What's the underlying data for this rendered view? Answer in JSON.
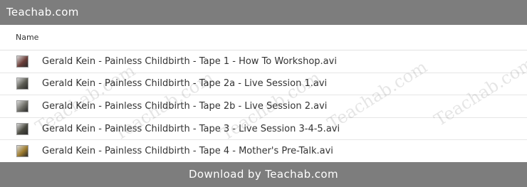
{
  "window": {
    "title": "Teachab.com"
  },
  "list": {
    "column_name": "Name",
    "files": [
      {
        "name": "Gerald Kein - Painless Childbirth - Tape 1 - How To Workshop.avi",
        "thumb_color": "#6b3d38"
      },
      {
        "name": "Gerald Kein - Painless Childbirth - Tape 2a - Live Session 1.avi",
        "thumb_color": "#5a5a52"
      },
      {
        "name": "Gerald Kein - Painless Childbirth - Tape 2b - Live Session 2.avi",
        "thumb_color": "#6d6d66"
      },
      {
        "name": "Gerald Kein - Painless Childbirth - Tape 3 - Live Session 3-4-5.avi",
        "thumb_color": "#4a4a40"
      },
      {
        "name": "Gerald Kein - Painless Childbirth - Tape 4 - Mother's Pre-Talk.avi",
        "thumb_color": "#9c7a2c"
      }
    ]
  },
  "watermark": {
    "text": "Teachab.com"
  },
  "footer": {
    "text": "Download by Teachab.com"
  },
  "colors": {
    "bar": "#7d7d7d",
    "text": "#333333"
  }
}
